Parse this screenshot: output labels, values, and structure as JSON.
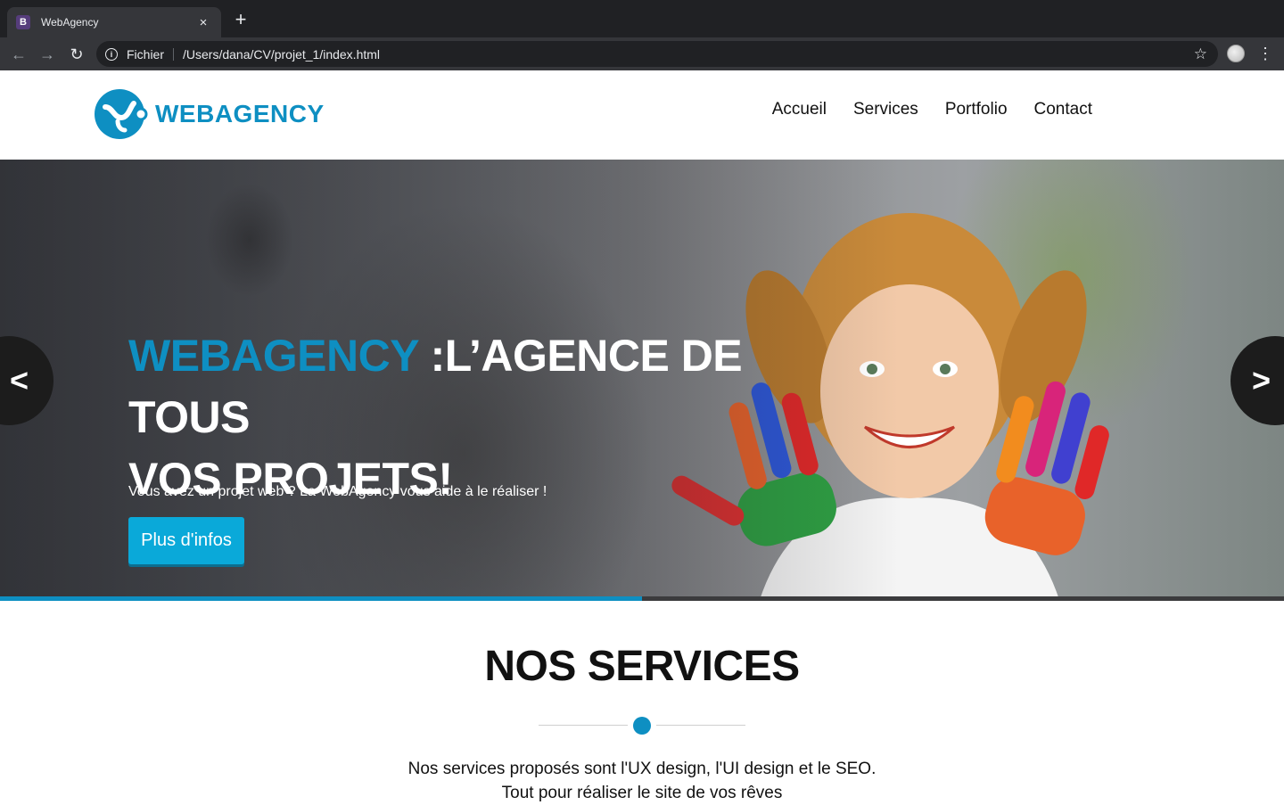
{
  "browser": {
    "tab_title": "WebAgency",
    "tab_favicon_letter": "B",
    "tab_close": "×",
    "new_tab": "+",
    "scheme_label": "Fichier",
    "url": "/Users/dana/CV/projet_1/index.html"
  },
  "site": {
    "logo_text": "WEBAGENCY",
    "nav": [
      "Accueil",
      "Services",
      "Portfolio",
      "Contact"
    ]
  },
  "hero": {
    "title_brand": "WEBAGENCY",
    "title_line1_rest": " :L’AGENCE DE TOUS",
    "title_line2": "VOS PROJETS!",
    "subtitle": "Vous avez un projet web ? La WebAgency vous aide à le réaliser !",
    "button_label": "Plus d'infos",
    "prev_label": "<",
    "next_label": ">",
    "progress_fraction": 0.5
  },
  "services": {
    "title": "NOS SERVICES",
    "line1": "Nos services proposés sont l'UX design, l'UI design et le SEO.",
    "line2": "Tout pour réaliser le site de vos rêves"
  },
  "colors": {
    "brand": "#0e8fc2",
    "button": "#0aa9d9"
  }
}
